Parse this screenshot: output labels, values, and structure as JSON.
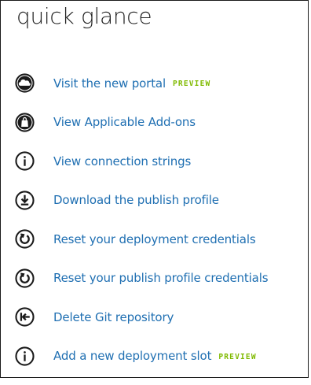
{
  "panel": {
    "title": "quick glance"
  },
  "colors": {
    "link": "#1f6fb2",
    "preview_badge": "#7fba00",
    "icon": "#1a1a1a"
  },
  "links": [
    {
      "label": "Visit the new portal",
      "icon": "cloud-icon",
      "badge": "PREVIEW"
    },
    {
      "label": "View Applicable Add-ons",
      "icon": "shopping-bag-icon"
    },
    {
      "label": "View connection strings",
      "icon": "info-icon"
    },
    {
      "label": "Download the publish profile",
      "icon": "download-icon"
    },
    {
      "label": "Reset your deployment credentials",
      "icon": "reset-icon"
    },
    {
      "label": "Reset your publish profile credentials",
      "icon": "reset-icon"
    },
    {
      "label": "Delete Git repository",
      "icon": "delete-git-icon"
    },
    {
      "label": "Add a new deployment slot",
      "icon": "info-icon",
      "badge": "PREVIEW"
    }
  ]
}
